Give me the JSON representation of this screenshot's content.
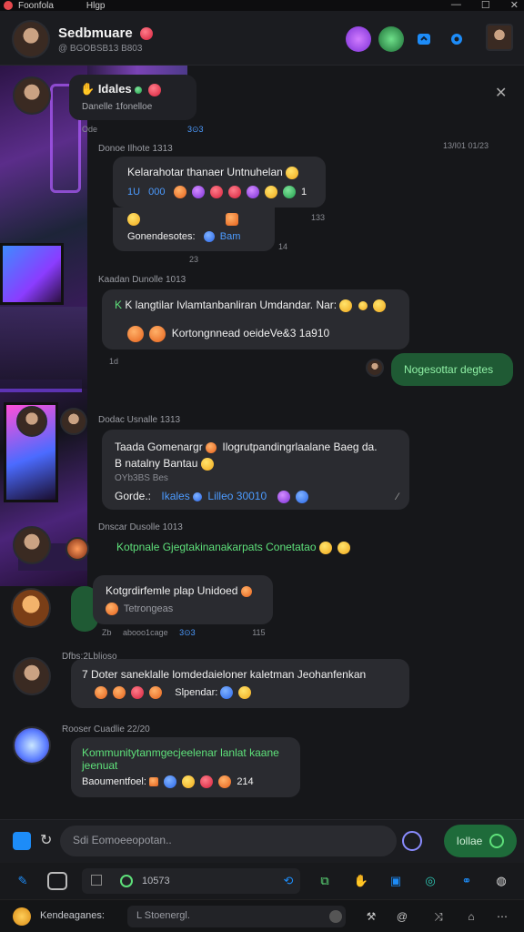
{
  "titlebar": {
    "title": "Foonfola",
    "menu": "Hlgp",
    "minimize": "—",
    "maximize": "☐",
    "close": "✕"
  },
  "header": {
    "name": "Sedbmuare",
    "subtitle": "@ BGOBSB13 B803",
    "accent": "#1d8cf8"
  },
  "pinned": {
    "title": "Idales",
    "preview": "Danelle 1fonelloe",
    "meta": "Ode",
    "meta2": "3⊙3"
  },
  "messages": [
    {
      "sender": "Donoe Ilhote",
      "sender_time": "1313",
      "right_meta": "13/I01 01/23",
      "text": "Kelarahotar thanaer Untnuhelan",
      "line2_start": "1U",
      "line2_mid": "000",
      "line2_end": "1",
      "aside_time": "133",
      "sub_label": "Gonendesotes:",
      "sub_link": "Bam",
      "sub_time": "14",
      "below_time": "23"
    },
    {
      "sender": "Kaadan Dunolle",
      "sender_time": "1013",
      "text": "K langtilar Ivlamtanbanliran Umdandar. Nar:",
      "footer": "Kortongnnead oeideVe&3 1a910",
      "side_time": "1d"
    },
    {
      "outgoing": "Nogesottar degtes"
    },
    {
      "sender": "Dodac Usnalle",
      "sender_time": "1313",
      "line1": "Taada Gomenargr",
      "line1b": "Ilogrutpandingrlaalane Baeg da.",
      "line2": "B natalny Bantau",
      "small": "OYb3BS Bes",
      "label": "Gorde.:",
      "link1": "Ikales",
      "link2": "Lilleo 30010"
    },
    {
      "sender": "Dnscar Dusolle",
      "sender_time": "1013",
      "text": "Kotpnale Gjegtakinanakarpats Conetatao"
    },
    {
      "title": "Kotgrdirfemle plap Unidoed",
      "sub": "Tetrongeas",
      "meta_left": "Zb",
      "meta_mid": "abooo1cage",
      "meta_icons": "3⊙3",
      "meta_time": "115"
    },
    {
      "sender": "Dfbs:2Lblioso",
      "text": "Doter saneklalle lomdedaieloner kaletman Jeohanfenkan",
      "sub_label": "Slpendar:"
    },
    {
      "sender": "Rooser Cuadlie",
      "sender_time": "22/20",
      "text": "Kommunitytanmgecjeelenar lanlat kaane jeenuat",
      "footer": "Baoumentfoel:",
      "footer_time": "214"
    }
  ],
  "composer": {
    "placeholder": "Sdi Eomoeeopotan..",
    "send_label": "Iollae"
  },
  "toolbar": {
    "timer": "10573"
  },
  "statusbar": {
    "label": "Kendeaganes:",
    "field": "L Stoenergl."
  }
}
